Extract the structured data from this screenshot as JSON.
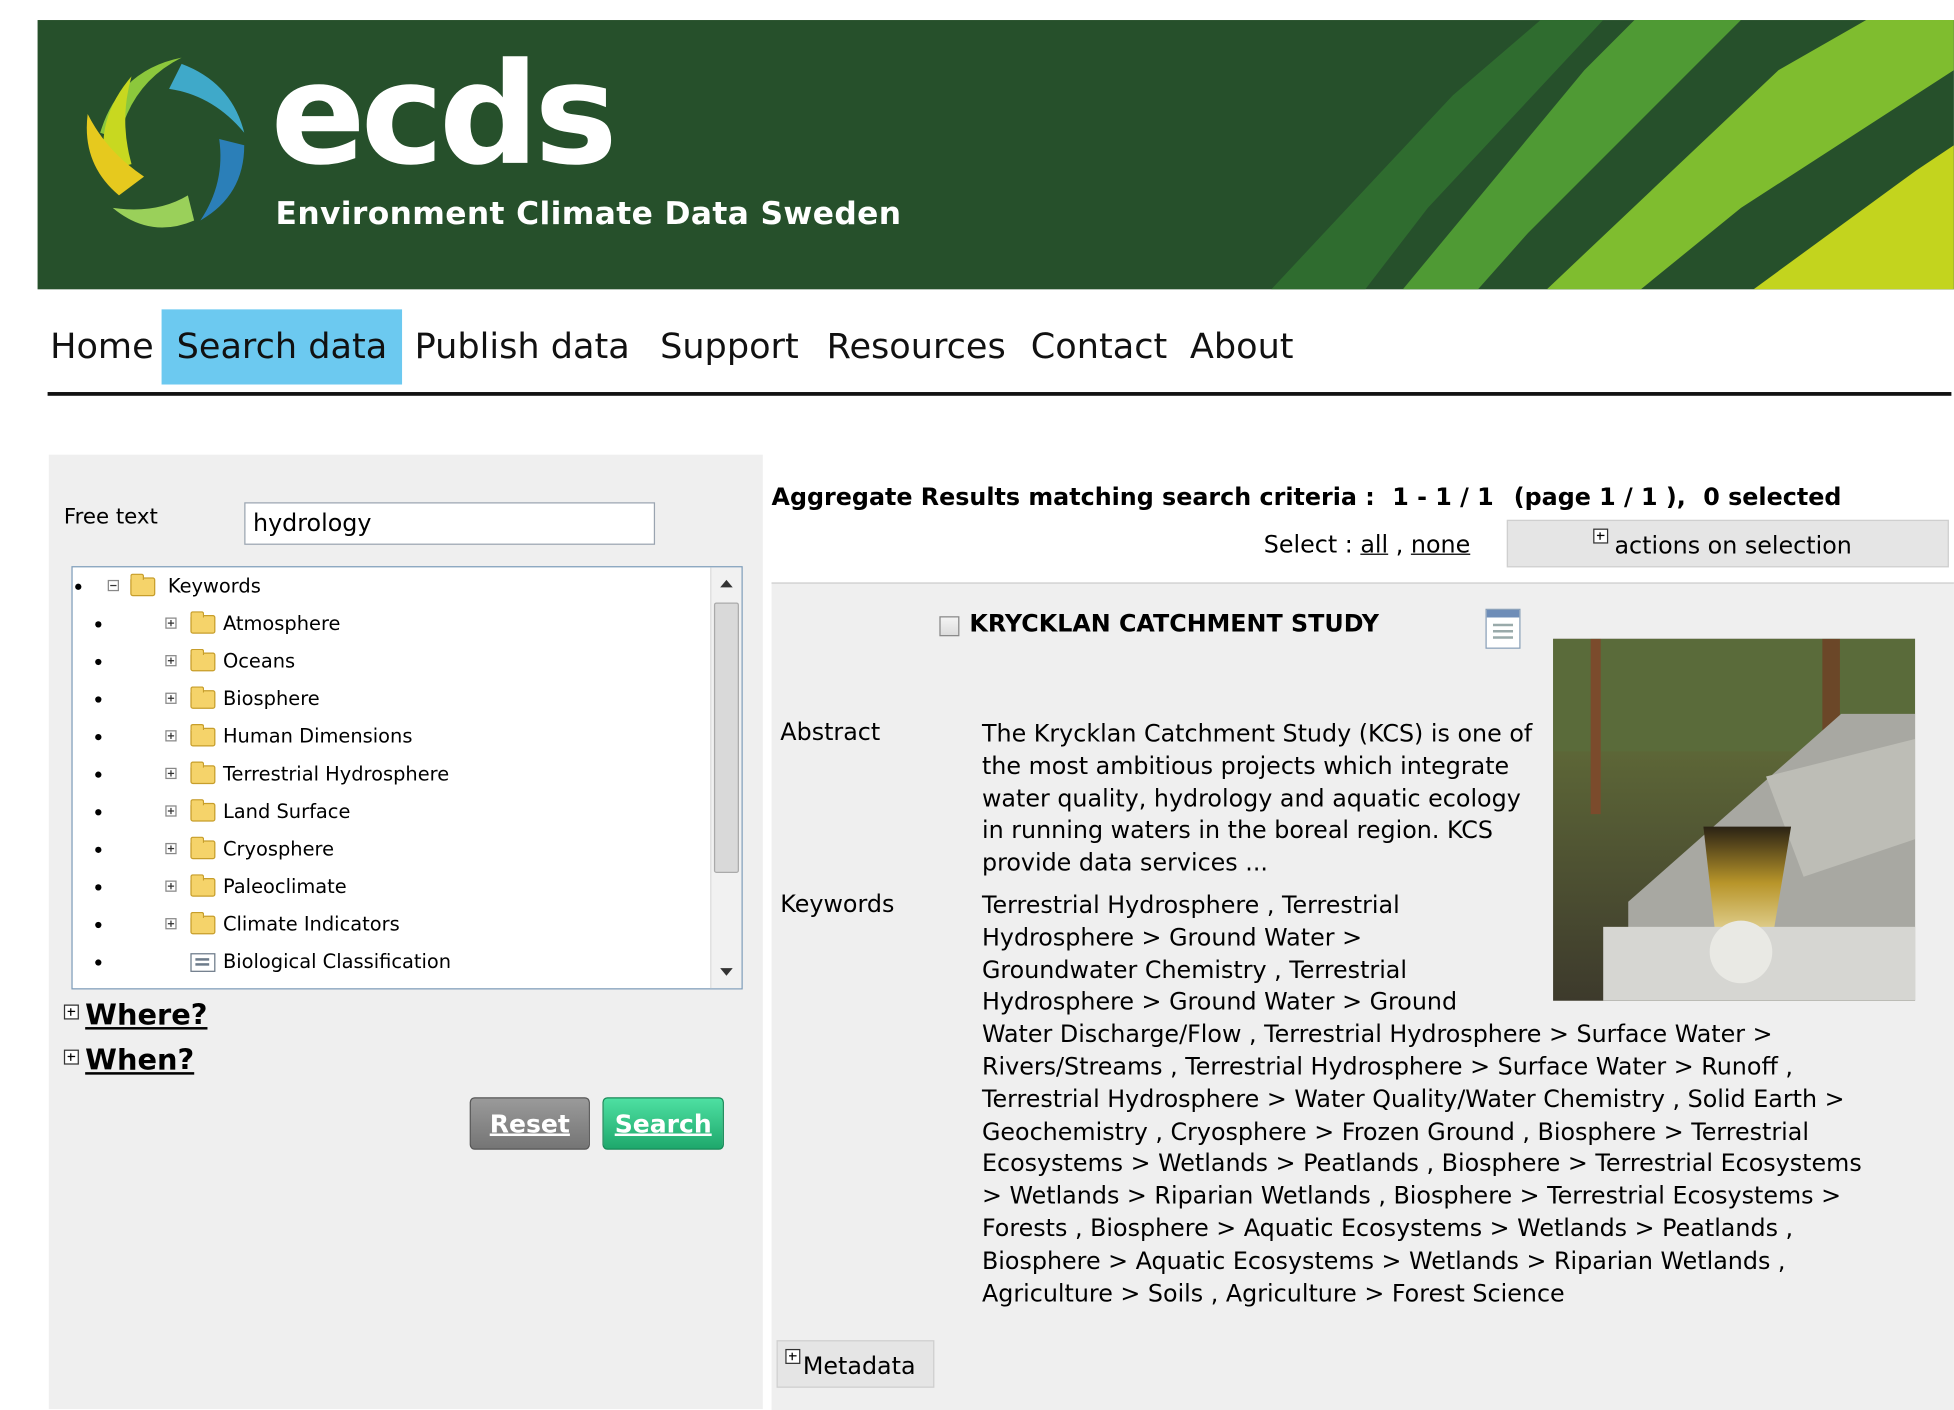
{
  "banner": {
    "logo": "ecds",
    "subtitle": "Environment Climate Data Sweden",
    "colors": {
      "background": "#26502b",
      "stripe_light": "#c8d820",
      "stripe_mid": "#6cb43c",
      "stripe_dark": "#3b8a34"
    }
  },
  "nav": {
    "items": [
      "Home",
      "Search data",
      "Publish data",
      "Support",
      "Resources",
      "Contact",
      "About"
    ],
    "active": "Search data",
    "active_color": "#6cc9f0"
  },
  "search": {
    "free_text_label": "Free text",
    "free_text_value": "hydrology",
    "tree": {
      "root": "Keywords",
      "items": [
        {
          "label": "Atmosphere",
          "icon": "folder-icon"
        },
        {
          "label": "Oceans",
          "icon": "folder-icon"
        },
        {
          "label": "Biosphere",
          "icon": "folder-icon"
        },
        {
          "label": "Human Dimensions",
          "icon": "folder-icon"
        },
        {
          "label": "Terrestrial Hydrosphere",
          "icon": "folder-icon"
        },
        {
          "label": "Land Surface",
          "icon": "folder-icon"
        },
        {
          "label": "Cryosphere",
          "icon": "folder-icon"
        },
        {
          "label": "Paleoclimate",
          "icon": "folder-icon"
        },
        {
          "label": "Climate Indicators",
          "icon": "folder-icon"
        },
        {
          "label": "Biological Classification",
          "icon": "document-list-icon"
        }
      ]
    },
    "where_label": "Where?",
    "when_label": "When?",
    "reset_label": "Reset",
    "search_label": "Search"
  },
  "results": {
    "header_label": "Aggregate Results matching search criteria :",
    "count": "1 - 1 / 1",
    "page": "(page 1 / 1 ),",
    "selected": "0 selected",
    "select_label": "Select :",
    "select_all": "all",
    "select_sep": ",",
    "select_none": "none",
    "actions_label": "actions on selection",
    "item": {
      "title": "KRYCKLAN CATCHMENT STUDY",
      "abstract_label": "Abstract",
      "abstract": "The Krycklan Catchment Study (KCS) is one of the most ambitious projects which integrate water quality, hydrology and aquatic ecology in running waters in the boreal region. KCS provide data services ...",
      "keywords_label": "Keywords",
      "keywords_lines": [
        "Terrestrial Hydrosphere , Terrestrial",
        "Hydrosphere > Ground Water >",
        "Groundwater Chemistry , Terrestrial",
        "Hydrosphere > Ground Water > Ground",
        "Water Discharge/Flow , Terrestrial Hydrosphere > Surface Water >",
        "Rivers/Streams , Terrestrial Hydrosphere > Surface Water > Runoff ,",
        "Terrestrial Hydrosphere > Water Quality/Water Chemistry , Solid Earth >",
        "Geochemistry , Cryosphere > Frozen Ground , Biosphere > Terrestrial",
        "Ecosystems > Wetlands > Peatlands , Biosphere > Terrestrial Ecosystems",
        "> Wetlands > Riparian Wetlands , Biosphere > Terrestrial Ecosystems >",
        "Forests , Biosphere > Aquatic Ecosystems > Wetlands > Peatlands ,",
        "Biosphere > Aquatic Ecosystems > Wetlands > Riparian Wetlands ,",
        "Agriculture > Soils , Agriculture > Forest Science"
      ],
      "metadata_label": "Metadata"
    }
  }
}
